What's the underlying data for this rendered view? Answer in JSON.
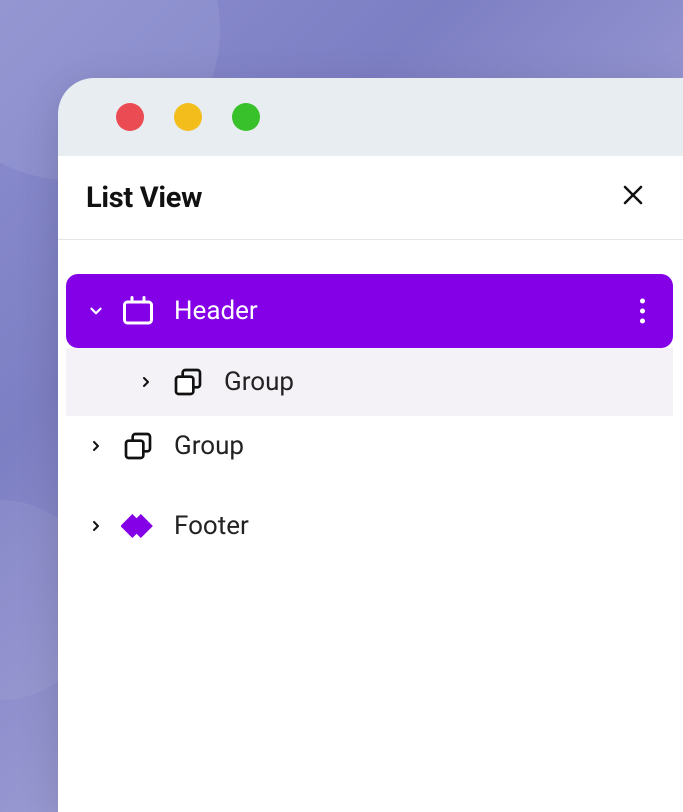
{
  "panel": {
    "title": "List View"
  },
  "tree": {
    "nodes": [
      {
        "label": "Header",
        "icon": "header-icon",
        "expanded": true,
        "selected": true,
        "level": 0,
        "hasChildren": true
      },
      {
        "label": "Group",
        "icon": "group-icon",
        "expanded": false,
        "selected": false,
        "level": 1,
        "hasChildren": true,
        "childHighlight": true
      },
      {
        "label": "Group",
        "icon": "group-icon",
        "expanded": false,
        "selected": false,
        "level": 0,
        "hasChildren": true
      },
      {
        "label": "Footer",
        "icon": "footer-icon",
        "expanded": false,
        "selected": false,
        "level": 0,
        "hasChildren": true
      }
    ]
  },
  "colors": {
    "accent": "#8400e7",
    "childBg": "#f4f2f7"
  }
}
